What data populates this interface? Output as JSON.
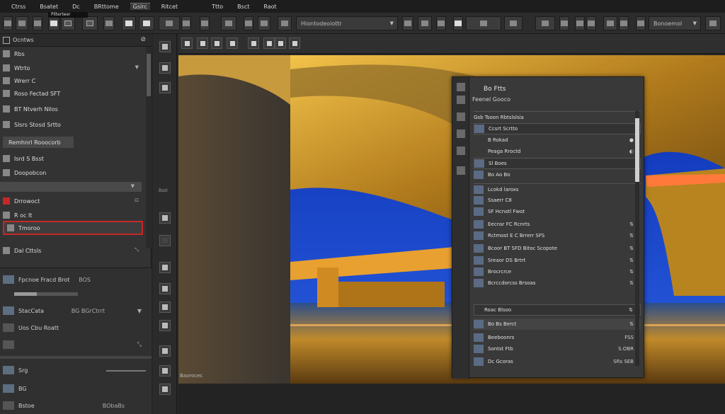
{
  "menubar": {
    "items": [
      "Ctrss",
      "Bsatet",
      "Dc",
      "BRttome",
      "Gslrc",
      "Ritcet",
      "Ttto",
      "Bsct",
      "Raot"
    ],
    "active_index": 4
  },
  "optbar": {
    "field1": "Hiontodeoiottr",
    "field2": "Bonoemol",
    "tooltip": "Pilterteer"
  },
  "left_panel": {
    "title": "Ocntws",
    "rows": [
      {
        "label": "Rbs"
      },
      {
        "label": "Wtrto"
      },
      {
        "label": "Wrerr C"
      },
      {
        "label": "Roso Fectad SFT"
      },
      {
        "label": "BT Ntverh Nilos"
      },
      {
        "label": "Slsrs Stosd Srtto"
      },
      {
        "label": "Remhnrl Rooocorb"
      },
      {
        "label": "Isrd S Bsst"
      },
      {
        "label": "Doopobcon"
      },
      {
        "label": "Drrowoct"
      },
      {
        "label": "R oc lt"
      },
      {
        "label": "Tmoroo"
      },
      {
        "label": "Dal Cttsls"
      }
    ],
    "lower": {
      "rows": [
        {
          "label": "Fpcnoe Fracd Brot",
          "meta": "BOS"
        },
        {
          "label": "StacCata",
          "meta": "BG BGrCtrrt"
        },
        {
          "label": "Uos Cbu Roatt"
        },
        {
          "label": ""
        },
        {
          "label": "Srg"
        },
        {
          "label": "BG"
        },
        {
          "label": "Bstoe",
          "meta": "BObaBs"
        }
      ]
    }
  },
  "toolstrip": {
    "label": "Bsst"
  },
  "canvas": {
    "caption": "Baorocec"
  },
  "float_panel": {
    "title": "Bo Ftts",
    "subtitle": "Feenel Gooco",
    "rows": [
      {
        "label": "Gsb Tsoon Rbtslslsia",
        "ri": ""
      },
      {
        "label": "Ccsrt Scrtto",
        "ri": ""
      },
      {
        "label": "B Rokad",
        "ri": "●"
      },
      {
        "label": "Peaga Rroctd",
        "ri": "◐"
      },
      {
        "label": "Sl Boes",
        "ri": ""
      },
      {
        "label": "Bo Ao Bo",
        "ri": ""
      },
      {
        "label": "Lcokd laroxs",
        "ri": ""
      },
      {
        "label": "Ssaerr C8",
        "ri": ""
      },
      {
        "label": "SF Hcnotl Fwot",
        "ri": ""
      },
      {
        "label": "Eecnsr FC Rcnrts",
        "ri": "⇅"
      },
      {
        "label": "Rctmost E C Brrerr SFS",
        "ri": "⇅"
      },
      {
        "label": "Bcoor BT SFD Bitoc Scopote",
        "ri": "⇅"
      },
      {
        "label": "Sreaor DS Brtrt",
        "ri": "⇅"
      },
      {
        "label": "Brocrcrce",
        "ri": "⇅"
      },
      {
        "label": "Bcrccdorcss Brsoas",
        "ri": "⇅"
      },
      {
        "label": "Roac Blsoo",
        "ri": "⇅"
      },
      {
        "label": "Bo Bs Berct",
        "ri": "⇅"
      },
      {
        "label": "Beeboonrs",
        "ri": "FSS"
      },
      {
        "label": "Sontst Ftb",
        "ri": "S.OBR"
      },
      {
        "label": "Dc Gcoras",
        "ri": "SRs SEB"
      }
    ]
  }
}
